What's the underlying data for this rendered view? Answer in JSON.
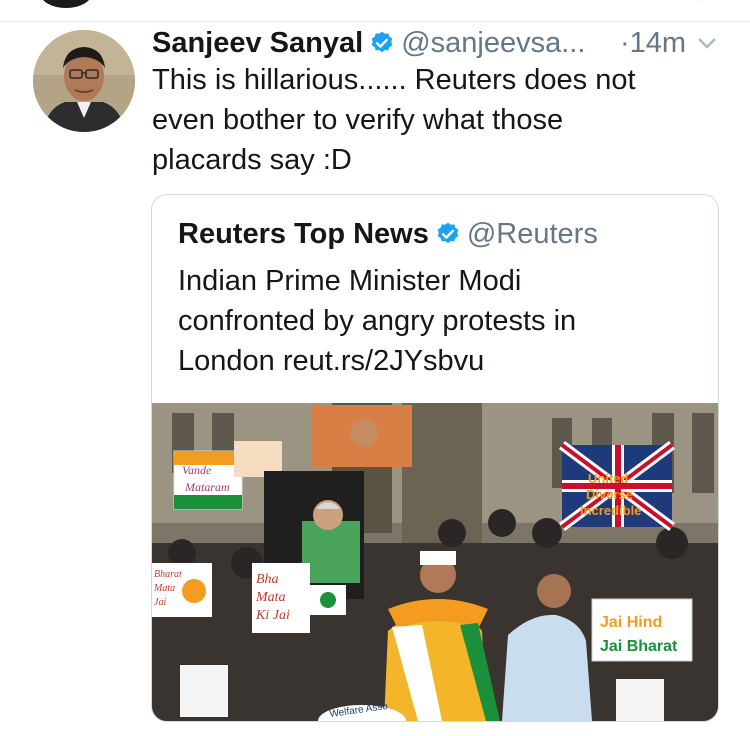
{
  "tweet": {
    "author_name": "Sanjeev Sanyal",
    "handle": "@sanjeevsa...",
    "time": "·14m",
    "text_lines": [
      "This is hillarious...... Reuters does not",
      "even bother to verify what those",
      "placards say :D"
    ]
  },
  "quoted_tweet": {
    "author_name": "Reuters Top News",
    "handle": "@Reuters",
    "text_lines": [
      "Indian Prime Minister Modi",
      "confronted by angry protests in",
      "London reut.rs/2JYsbvu"
    ]
  },
  "photo": {
    "placards": {
      "vande": [
        "Vande",
        "Mataram"
      ],
      "bharat_left": [
        "Bharat",
        "Mata",
        "Jai"
      ],
      "bharat_center": [
        "Bha",
        "Mata",
        "Ki Jai"
      ],
      "united": [
        "United",
        "Diverse",
        "Incredible"
      ],
      "jai_hind": [
        "Jai Hind",
        "Jai Bharat"
      ]
    },
    "banner_fragment": "Welfare Asso"
  },
  "colors": {
    "verified_blue": "#1da1f2",
    "secondary_text": "#657786",
    "border": "#cfd9de",
    "saffron": "#f39c1f",
    "india_green": "#1b8f3a"
  },
  "icons": [
    "verified-badge-icon",
    "chevron-down-icon"
  ]
}
